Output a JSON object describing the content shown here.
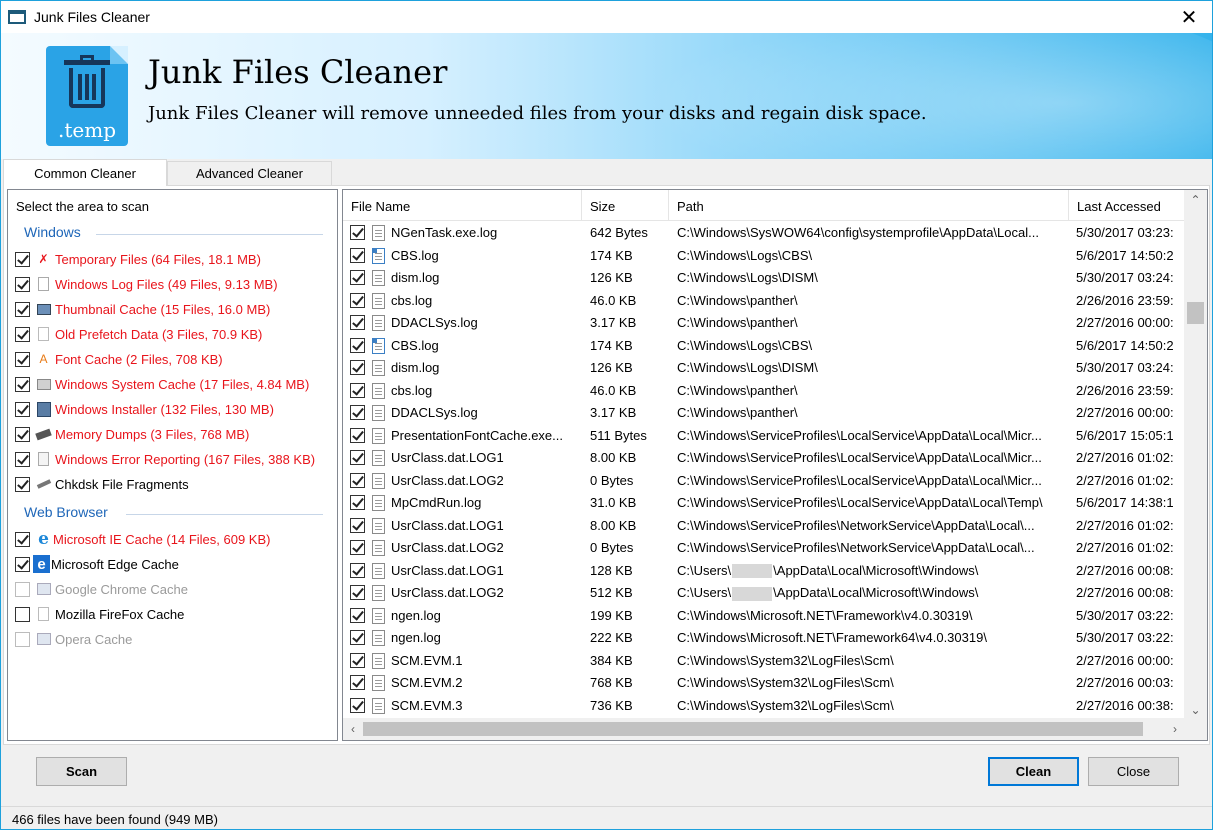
{
  "window": {
    "title": "Junk Files Cleaner",
    "close": "✕"
  },
  "banner": {
    "icon_ext": ".temp",
    "title": "Junk Files Cleaner",
    "subtitle": "Junk Files Cleaner will remove unneeded files from your disks and regain disk space."
  },
  "tabs": [
    {
      "label": "Common Cleaner",
      "active": true
    },
    {
      "label": "Advanced Cleaner",
      "active": false
    }
  ],
  "left": {
    "heading": "Select the area to scan",
    "groups": {
      "windows": "Windows",
      "web": "Web Browser"
    },
    "items": [
      {
        "label": "Temporary Files (64 Files, 18.1 MB)",
        "checked": true,
        "style": "red",
        "icon": "temp-files-icon"
      },
      {
        "label": "Windows Log Files (49 Files, 9.13 MB)",
        "checked": true,
        "style": "red",
        "icon": "log-files-icon"
      },
      {
        "label": "Thumbnail Cache (15 Files, 16.0 MB)",
        "checked": true,
        "style": "red",
        "icon": "thumbnail-icon"
      },
      {
        "label": "Old Prefetch Data (3 Files, 70.9 KB)",
        "checked": true,
        "style": "red",
        "icon": "prefetch-icon"
      },
      {
        "label": "Font Cache (2 Files, 708 KB)",
        "checked": true,
        "style": "red",
        "icon": "font-icon"
      },
      {
        "label": "Windows System Cache (17 Files, 4.84 MB)",
        "checked": true,
        "style": "red",
        "icon": "system-cache-icon"
      },
      {
        "label": "Windows Installer (132 Files, 130 MB)",
        "checked": true,
        "style": "red",
        "icon": "installer-icon"
      },
      {
        "label": "Memory Dumps (3 Files, 768 MB)",
        "checked": true,
        "style": "red",
        "icon": "memory-icon"
      },
      {
        "label": "Windows Error Reporting (167 Files, 388 KB)",
        "checked": true,
        "style": "red",
        "icon": "error-report-icon"
      },
      {
        "label": "Chkdsk File Fragments",
        "checked": true,
        "style": "normal",
        "icon": "chkdsk-icon"
      },
      {
        "label": "Microsoft IE Cache (14 Files, 609 KB)",
        "checked": true,
        "style": "red",
        "icon": "ie-icon"
      },
      {
        "label": "Microsoft Edge Cache",
        "checked": true,
        "style": "normal",
        "icon": "edge-icon"
      },
      {
        "label": "Google Chrome Cache",
        "checked": false,
        "style": "gray",
        "icon": "chrome-icon"
      },
      {
        "label": "Mozilla FireFox Cache",
        "checked": false,
        "style": "normal",
        "icon": "firefox-icon"
      },
      {
        "label": "Opera Cache",
        "checked": false,
        "style": "gray",
        "icon": "opera-icon"
      }
    ]
  },
  "table": {
    "columns": [
      "File Name",
      "Size",
      "Path",
      "Last Accessed"
    ],
    "rows": [
      {
        "name": "NGenTask.exe.log",
        "size": "642 Bytes",
        "path": "C:\\Windows\\SysWOW64\\config\\systemprofile\\AppData\\Local...",
        "accessed": "5/30/2017 03:23:",
        "icon": "plain"
      },
      {
        "name": "CBS.log",
        "size": "174 KB",
        "path": "C:\\Windows\\Logs\\CBS\\",
        "accessed": "5/6/2017 14:50:2",
        "icon": "blue"
      },
      {
        "name": "dism.log",
        "size": "126 KB",
        "path": "C:\\Windows\\Logs\\DISM\\",
        "accessed": "5/30/2017 03:24:",
        "icon": "plain"
      },
      {
        "name": "cbs.log",
        "size": "46.0 KB",
        "path": "C:\\Windows\\panther\\",
        "accessed": "2/26/2016 23:59:",
        "icon": "plain"
      },
      {
        "name": "DDACLSys.log",
        "size": "3.17 KB",
        "path": "C:\\Windows\\panther\\",
        "accessed": "2/27/2016 00:00:",
        "icon": "plain"
      },
      {
        "name": "CBS.log",
        "size": "174 KB",
        "path": "C:\\Windows\\Logs\\CBS\\",
        "accessed": "5/6/2017 14:50:2",
        "icon": "blue"
      },
      {
        "name": "dism.log",
        "size": "126 KB",
        "path": "C:\\Windows\\Logs\\DISM\\",
        "accessed": "5/30/2017 03:24:",
        "icon": "plain"
      },
      {
        "name": "cbs.log",
        "size": "46.0 KB",
        "path": "C:\\Windows\\panther\\",
        "accessed": "2/26/2016 23:59:",
        "icon": "plain"
      },
      {
        "name": "DDACLSys.log",
        "size": "3.17 KB",
        "path": "C:\\Windows\\panther\\",
        "accessed": "2/27/2016 00:00:",
        "icon": "plain"
      },
      {
        "name": "PresentationFontCache.exe...",
        "size": "511 Bytes",
        "path": "C:\\Windows\\ServiceProfiles\\LocalService\\AppData\\Local\\Micr...",
        "accessed": "5/6/2017 15:05:1",
        "icon": "plain"
      },
      {
        "name": "UsrClass.dat.LOG1",
        "size": "8.00 KB",
        "path": "C:\\Windows\\ServiceProfiles\\LocalService\\AppData\\Local\\Micr...",
        "accessed": "2/27/2016 01:02:",
        "icon": "plain"
      },
      {
        "name": "UsrClass.dat.LOG2",
        "size": "0 Bytes",
        "path": "C:\\Windows\\ServiceProfiles\\LocalService\\AppData\\Local\\Micr...",
        "accessed": "2/27/2016 01:02:",
        "icon": "plain"
      },
      {
        "name": "MpCmdRun.log",
        "size": "31.0 KB",
        "path": "C:\\Windows\\ServiceProfiles\\LocalService\\AppData\\Local\\Temp\\",
        "accessed": "5/6/2017 14:38:1",
        "icon": "plain"
      },
      {
        "name": "UsrClass.dat.LOG1",
        "size": "8.00 KB",
        "path": "C:\\Windows\\ServiceProfiles\\NetworkService\\AppData\\Local\\...",
        "accessed": "2/27/2016 01:02:",
        "icon": "plain"
      },
      {
        "name": "UsrClass.dat.LOG2",
        "size": "0 Bytes",
        "path": "C:\\Windows\\ServiceProfiles\\NetworkService\\AppData\\Local\\...",
        "accessed": "2/27/2016 01:02:",
        "icon": "plain"
      },
      {
        "name": "UsrClass.dat.LOG1",
        "size": "128 KB",
        "path": "C:\\Users\\",
        "path_tail": "\\AppData\\Local\\Microsoft\\Windows\\",
        "accessed": "2/27/2016 00:08:",
        "icon": "plain",
        "redacted": true
      },
      {
        "name": "UsrClass.dat.LOG2",
        "size": "512 KB",
        "path": "C:\\Users\\",
        "path_tail": "\\AppData\\Local\\Microsoft\\Windows\\",
        "accessed": "2/27/2016 00:08:",
        "icon": "plain",
        "redacted": true
      },
      {
        "name": "ngen.log",
        "size": "199 KB",
        "path": "C:\\Windows\\Microsoft.NET\\Framework\\v4.0.30319\\",
        "accessed": "5/30/2017 03:22:",
        "icon": "plain"
      },
      {
        "name": "ngen.log",
        "size": "222 KB",
        "path": "C:\\Windows\\Microsoft.NET\\Framework64\\v4.0.30319\\",
        "accessed": "5/30/2017 03:22:",
        "icon": "plain"
      },
      {
        "name": "SCM.EVM.1",
        "size": "384 KB",
        "path": "C:\\Windows\\System32\\LogFiles\\Scm\\",
        "accessed": "2/27/2016 00:00:",
        "icon": "plain"
      },
      {
        "name": "SCM.EVM.2",
        "size": "768 KB",
        "path": "C:\\Windows\\System32\\LogFiles\\Scm\\",
        "accessed": "2/27/2016 00:03:",
        "icon": "plain"
      },
      {
        "name": "SCM.EVM.3",
        "size": "736 KB",
        "path": "C:\\Windows\\System32\\LogFiles\\Scm\\",
        "accessed": "2/27/2016 00:38:",
        "icon": "plain"
      }
    ]
  },
  "buttons": {
    "scan": "Scan",
    "clean": "Clean",
    "close": "Close"
  },
  "status": "466  files have been found (949 MB)",
  "colors": {
    "accent": "#0078d7",
    "group": "#1e66b8",
    "found": "#e8141b"
  }
}
